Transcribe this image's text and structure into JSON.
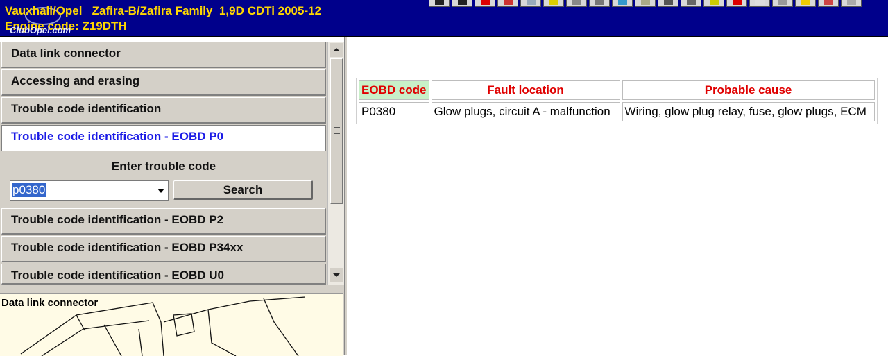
{
  "header": {
    "title_line1": "Vauxhall/Opel   Zafira-B/Zafira Family  1,9D CDTi 2005-12",
    "title_line2": "Engine code: Z19DTH",
    "logo_text": "ClubOpel.com",
    "toolbar_icons": [
      "n-icon",
      "p-icon",
      "warning-icon",
      "flag-icon",
      "mail-icon",
      "lightbulb-icon",
      "wrench-icon",
      "refresh-icon",
      "info-icon",
      "document-icon",
      "printer-icon",
      "settings-icon",
      "checkmark-icon",
      "red-tool-icon",
      "blank-icon",
      "compare-icon",
      "key-icon",
      "folder-icon",
      "print-preview-icon"
    ]
  },
  "sidebar": {
    "items_top": [
      {
        "label": "Data link connector"
      },
      {
        "label": "Accessing and erasing"
      },
      {
        "label": "Trouble code identification"
      },
      {
        "label": "Trouble code identification - EOBD P0",
        "selected": true
      }
    ],
    "entry": {
      "label": "Enter trouble code",
      "value": "p0380",
      "search_label": "Search"
    },
    "items_bottom": [
      {
        "label": "Trouble code identification - EOBD P2"
      },
      {
        "label": "Trouble code identification - EOBD P34xx"
      },
      {
        "label": "Trouble code identification - EOBD U0"
      }
    ]
  },
  "diagram": {
    "title": "Data link connector"
  },
  "table": {
    "headers": [
      "EOBD code",
      "Fault location",
      "Probable cause"
    ],
    "rows": [
      [
        "P0380",
        "Glow plugs, circuit A - malfunction",
        "Wiring, glow plug relay, fuse, glow plugs, ECM"
      ]
    ]
  },
  "colors": {
    "header_bg": "#00008b",
    "header_text": "#ffd700",
    "selected_item_text": "#1a1ae6",
    "table_header_text": "#e00000",
    "table_first_header_bg": "#c8f0c8"
  }
}
